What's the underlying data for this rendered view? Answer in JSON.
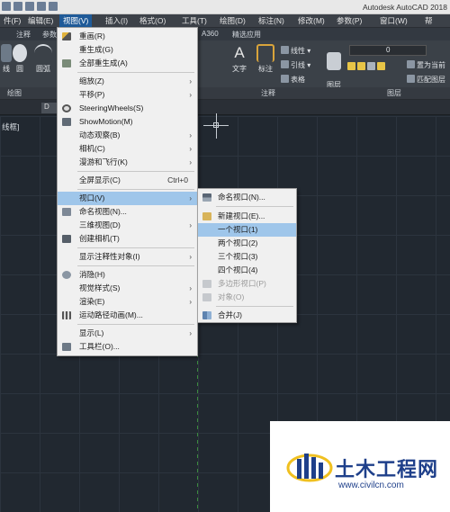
{
  "app_title": "Autodesk AutoCAD 2018",
  "menubar": [
    {
      "label": "件(F)"
    },
    {
      "label": "编辑(E)"
    },
    {
      "label": "视图(V)"
    },
    {
      "label": "插入(I)"
    },
    {
      "label": "格式(O)"
    },
    {
      "label": "工具(T)"
    },
    {
      "label": "绘图(D)"
    },
    {
      "label": "标注(N)"
    },
    {
      "label": "修改(M)"
    },
    {
      "label": "参数(P)"
    },
    {
      "label": "窗口(W)"
    },
    {
      "label": "帮"
    }
  ],
  "ribbon_tabs": [
    "注释",
    "参数",
    "A360",
    "精选应用"
  ],
  "ribbon_tools": {
    "line": "线",
    "circle": "圆",
    "arc": "圆弧",
    "text": "文字",
    "dimension": "标注",
    "linetype": "线性",
    "leader": "引线",
    "table": "表格",
    "layer_properties": "图层\n特性",
    "layer_value": "0",
    "layer_tools": [
      "置为当前",
      "匹配图层"
    ]
  },
  "panel_labels": [
    "绘图",
    "注释",
    "图层"
  ],
  "doc_tab_label": "D",
  "canvas_label": "线框]",
  "view_menu": {
    "items": [
      {
        "label": "重画(R)",
        "icon": "redraw-icon"
      },
      {
        "label": "重生成(G)",
        "icon": ""
      },
      {
        "label": "全部重生成(A)",
        "icon": "regen-all-icon"
      },
      {
        "label": "缩放(Z)",
        "submenu": true
      },
      {
        "label": "平移(P)",
        "submenu": true
      },
      {
        "label": "SteeringWheels(S)",
        "icon": "steeringwheels-icon"
      },
      {
        "label": "ShowMotion(M)",
        "icon": "showmotion-icon"
      },
      {
        "label": "动态观察(B)",
        "submenu": true
      },
      {
        "label": "相机(C)",
        "submenu": true
      },
      {
        "label": "漫游和飞行(K)",
        "submenu": true
      },
      {
        "label": "全屏显示(C)",
        "shortcut": "Ctrl+0"
      },
      {
        "label": "视口(V)",
        "submenu": true,
        "highlighted": true
      },
      {
        "label": "命名视图(N)...",
        "icon": "named-views-icon"
      },
      {
        "label": "三维视图(D)",
        "submenu": true
      },
      {
        "label": "创建相机(T)",
        "icon": "camera-icon"
      },
      {
        "label": "显示注释性对象(I)",
        "submenu": true
      },
      {
        "label": "消隐(H)",
        "icon": "hide-icon"
      },
      {
        "label": "视觉样式(S)",
        "submenu": true
      },
      {
        "label": "渲染(E)",
        "submenu": true
      },
      {
        "label": "运动路径动画(M)...",
        "icon": "motion-path-icon"
      },
      {
        "label": "显示(L)",
        "submenu": true
      },
      {
        "label": "工具栏(O)...",
        "icon": "toolbar-icon"
      }
    ]
  },
  "viewport_submenu": {
    "items": [
      {
        "label": "命名视口(N)...",
        "icon": "named-viewports-icon"
      },
      {
        "label": "新建视口(E)...",
        "icon": "new-viewport-icon"
      },
      {
        "label": "一个视口(1)",
        "highlighted": true
      },
      {
        "label": "两个视口(2)"
      },
      {
        "label": "三个视口(3)"
      },
      {
        "label": "四个视口(4)"
      },
      {
        "label": "多边形视口(P)",
        "disabled": true,
        "icon": "polygon-viewport-icon"
      },
      {
        "label": "对象(O)",
        "disabled": true,
        "icon": "object-viewport-icon"
      },
      {
        "label": "合并(J)",
        "icon": "join-icon"
      }
    ]
  },
  "watermark": {
    "name": "土木工程网",
    "url": "www.civilcn.com"
  },
  "colors": {
    "canvas_bg": "#212830",
    "menu_bg": "#f0f0f0",
    "highlight": "#9fc6ea",
    "menubar_active": "#1f5a98",
    "watermark_blue": "#1e3f8a"
  }
}
